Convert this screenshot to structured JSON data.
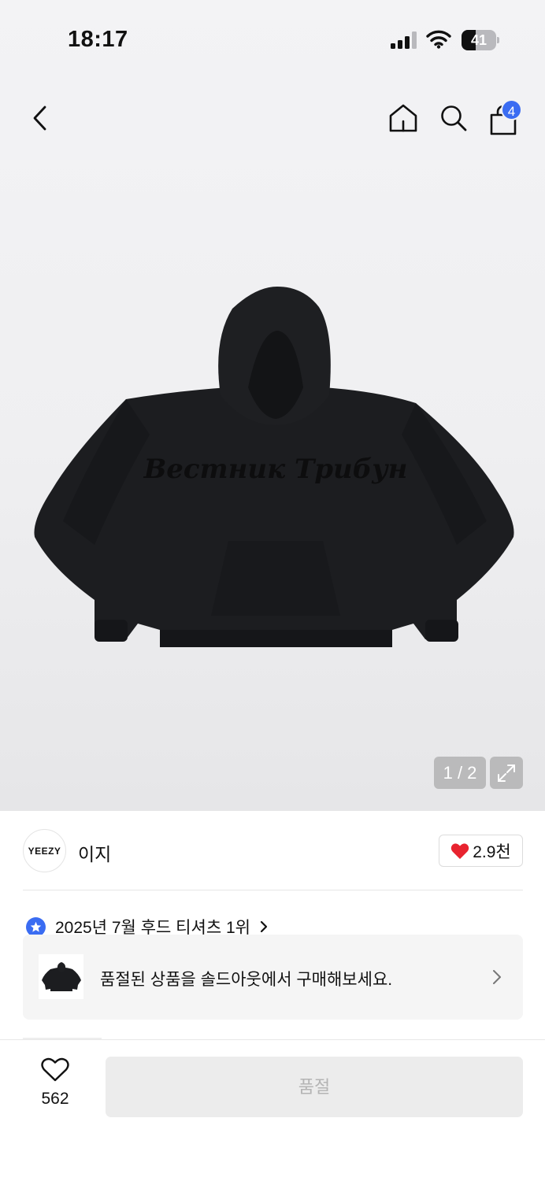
{
  "status_bar": {
    "time": "18:17",
    "battery_level": "41"
  },
  "header": {
    "cart_count": "4"
  },
  "product_image": {
    "print_text": "Вестник Трибун"
  },
  "gallery": {
    "counter": "1 / 2"
  },
  "brand": {
    "logo_text": "YEEZY",
    "name": "이지",
    "like_count": "2.9천"
  },
  "ranking": {
    "text": "2025년 7월 후드 티셔츠 1위"
  },
  "soldout_banner": {
    "text": "품절된 상품을 솔드아웃에서 구매해보세요."
  },
  "bottom_bar": {
    "wish_count": "562",
    "buy_label": "품절"
  },
  "colors": {
    "accent_blue": "#3a6cf2",
    "heart_red": "#e8232f",
    "disabled_button": "#ececec"
  },
  "icons": [
    "back-icon",
    "home-icon",
    "search-icon",
    "shopping-bag-icon",
    "expand-icon",
    "heart-icon",
    "star-badge-icon",
    "chevron-right-icon"
  ]
}
